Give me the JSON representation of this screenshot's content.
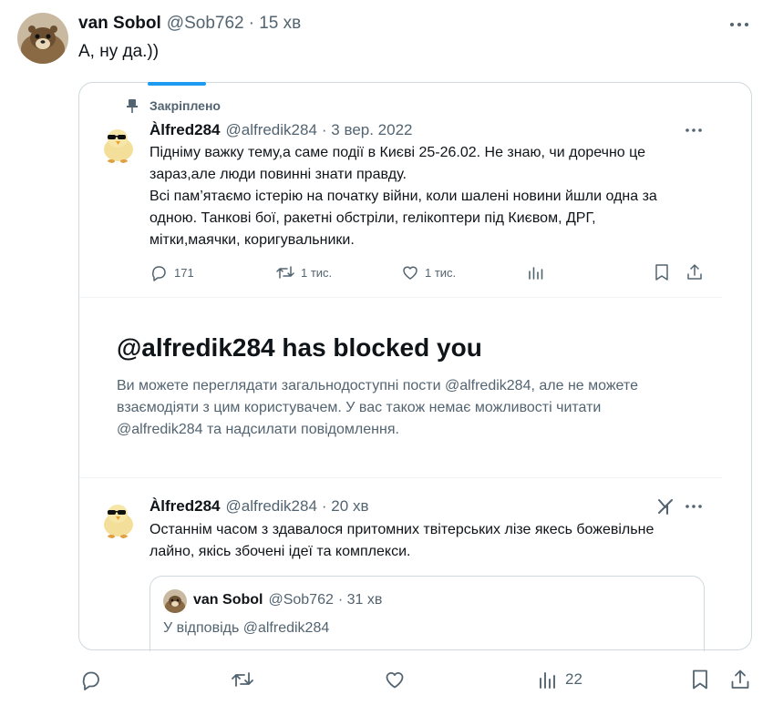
{
  "outer_tweet": {
    "display_name": "van Sobol",
    "handle": "@Sob762",
    "time": "· 15 хв",
    "text": "А, ну да.))"
  },
  "pinned_label": "Закріплено",
  "pinned_tweet": {
    "display_name": "Àlfred284",
    "handle": "@alfredik284",
    "time": "· 3 вер. 2022",
    "lines": [
      "Підніму важку тему,а саме події в Києві 25-26.02. Не знаю, чи доречно це",
      "зараз,але люди повинні знати правду.",
      "Всі пам’ятаємо істерію на початку війни, коли шалені новини йшли одна за",
      "одною. Танкові бої, ракетні обстріли, гелікоптери під Києвом, ДРГ,",
      "мітки,маячки, коригувальники."
    ],
    "replies": "171",
    "retweets": "1 тис.",
    "likes": "1 тис."
  },
  "blocked": {
    "title": "@alfredik284 has blocked you",
    "lines": [
      "Ви можете переглядати загальнодоступні пости @alfredik284, але не можете",
      "взаємодіяти з цим користувачем. У вас також немає можливості читати",
      "@alfredik284 та надсилати повідомлення."
    ]
  },
  "recent_tweet": {
    "display_name": "Àlfred284",
    "handle": "@alfredik284",
    "time": "· 20 хв",
    "lines": [
      "Останнім часом з здавалося притомних твітерських лізе якесь божевільне",
      "лайно, якісь збочені ідеї та комплекси."
    ]
  },
  "nested_quote": {
    "display_name": "van Sobol",
    "handle": "@Sob762",
    "time": "· 31 хв",
    "reply_to": "У відповідь @alfredik284"
  },
  "outer_actions": {
    "views": "22"
  },
  "icons": {
    "more": "more-horizontal-icon",
    "pin": "pin-icon",
    "reply": "reply-icon",
    "retweet": "retweet-icon",
    "like": "heart-icon",
    "views": "views-icon",
    "bookmark": "bookmark-icon",
    "share": "share-icon",
    "grok": "grok-icon"
  },
  "colors": {
    "accent": "#1d9bf0",
    "muted": "#536471",
    "text": "#0f1419",
    "border": "#cfd9de"
  }
}
